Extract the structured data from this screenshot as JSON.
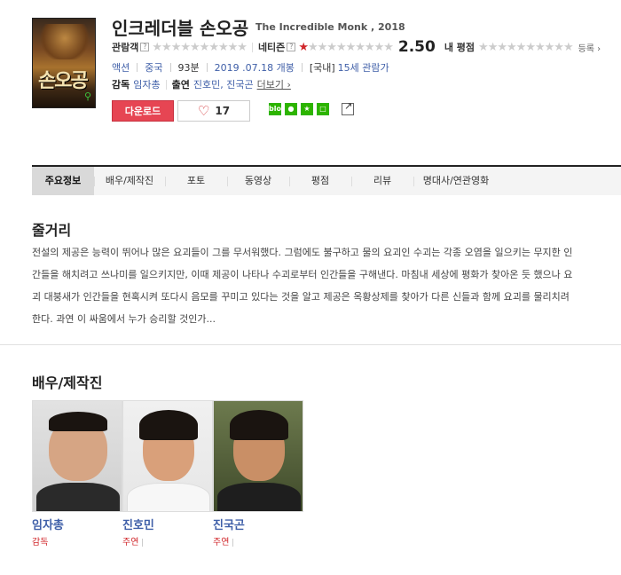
{
  "movie": {
    "title_ko": "인크레더블 손오공",
    "title_en": "The Incredible Monk , 2018",
    "poster_text": "손오공"
  },
  "ratings": {
    "audience_label": "관람객",
    "audience_stars": 0,
    "netizen_label": "네티즌",
    "netizen_stars": 1,
    "netizen_score": "2.50",
    "my_label": "내 평점",
    "my_stars": 0,
    "register_label": "등록 ›",
    "help_icon": "?"
  },
  "meta": {
    "genre": "액션",
    "country": "중국",
    "runtime": "93분",
    "release": "2019 .07.18 개봉",
    "rating_prefix": "[국내]",
    "rating": "15세 관람가"
  },
  "credits": {
    "director_label": "감독",
    "director": "임자총",
    "cast_label": "출연",
    "cast": "진호민, 진국곤",
    "more_label": "더보기 ›"
  },
  "actions": {
    "download_label": "다운로드",
    "like_count": "17",
    "blog_label": "blog"
  },
  "tabs": [
    {
      "label": "주요정보",
      "active": true
    },
    {
      "label": "배우/제작진"
    },
    {
      "label": "포토"
    },
    {
      "label": "동영상"
    },
    {
      "label": "평점"
    },
    {
      "label": "리뷰"
    },
    {
      "label": "명대사/연관영화"
    }
  ],
  "synopsis": {
    "heading": "줄거리",
    "text": "전설의 제공은 능력이 뛰어나 많은 요괴들이 그를 무서워했다. 그럼에도 불구하고 물의 요괴인 수괴는 각종 오염을 일으키는 무지한 인간들을 해치려고 쓰나미를 일으키지만, 이때 제공이 나타나 수괴로부터 인간들을 구해낸다. 마침내 세상에 평화가 찾아온 듯 했으나 요괴 대붕새가 인간들을 현혹시켜 또다시 음모를 꾸미고 있다는 것을 알고 제공은 옥황상제를 찾아가 다른 신들과 함께 요괴를 물리치려 한다. 과연 이 싸움에서 누가 승리할 것인가..."
  },
  "cast_section": {
    "heading": "배우/제작진",
    "people": [
      {
        "name": "임자총",
        "role": "감독"
      },
      {
        "name": "진호민",
        "role": "주연"
      },
      {
        "name": "진국곤",
        "role": "주연"
      }
    ]
  },
  "colors": {
    "accent_red": "#e64553",
    "link_blue": "#3f5fa8",
    "star_red": "#d0262a"
  }
}
